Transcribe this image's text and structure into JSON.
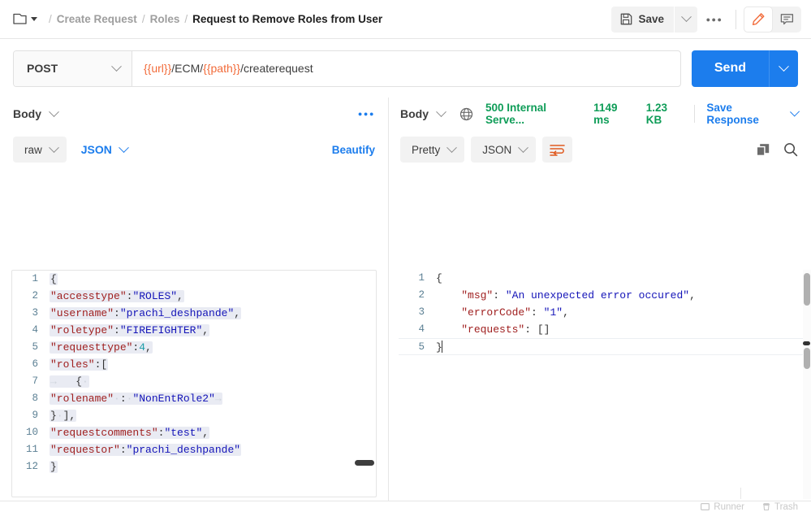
{
  "header": {
    "breadcrumb": {
      "folder_icon": "folder-icon",
      "caret_icon": "caret-down-icon",
      "sep": "/",
      "items": [
        {
          "label": "Create Request",
          "current": false
        },
        {
          "label": "Roles",
          "current": false
        },
        {
          "label": "Request to Remove Roles from User",
          "current": true
        }
      ]
    },
    "save_label": "Save",
    "save_icon": "floppy-disk-icon",
    "save_caret_icon": "chevron-down-icon",
    "more_label": "000",
    "more_icon": "ellipsis-icon",
    "edit_icon": "pencil-icon",
    "comment_icon": "comment-icon"
  },
  "request": {
    "method": "POST",
    "method_caret_icon": "chevron-down-icon",
    "url_parts": [
      {
        "text": "{{url}}",
        "variable": true
      },
      {
        "text": "/ECM/",
        "variable": false
      },
      {
        "text": "{{path}}",
        "variable": true
      },
      {
        "text": "/createrequest",
        "variable": false
      }
    ],
    "url_full": "{{url}}/ECM/{{path}}/createrequest",
    "send_label": "Send",
    "send_caret_icon": "chevron-down-icon"
  },
  "request_body": {
    "section_title": "Body",
    "section_caret_icon": "chevron-down-icon",
    "more_icon": "ellipsis-icon",
    "mode_label": "raw",
    "mode_caret_icon": "chevron-down-icon",
    "lang_label": "JSON",
    "lang_caret_icon": "chevron-down-icon",
    "beautify_label": "Beautify",
    "lines": [
      {
        "no": "1",
        "tokens": [
          {
            "t": "{",
            "c": "p"
          }
        ]
      },
      {
        "no": "2",
        "tokens": [
          {
            "t": "\"accesstype\"",
            "c": "k"
          },
          {
            "t": ":",
            "c": "p"
          },
          {
            "t": "\"ROLES\"",
            "c": "s"
          },
          {
            "t": ",",
            "c": "p"
          }
        ]
      },
      {
        "no": "3",
        "tokens": [
          {
            "t": "\"username\"",
            "c": "k"
          },
          {
            "t": ":",
            "c": "p"
          },
          {
            "t": "\"prachi_deshpande\"",
            "c": "s"
          },
          {
            "t": ",",
            "c": "p"
          }
        ]
      },
      {
        "no": "4",
        "tokens": [
          {
            "t": "\"roletype\"",
            "c": "k"
          },
          {
            "t": ":",
            "c": "p"
          },
          {
            "t": "\"FIREFIGHTER\"",
            "c": "s"
          },
          {
            "t": ",",
            "c": "p"
          }
        ]
      },
      {
        "no": "5",
        "tokens": [
          {
            "t": "\"requesttype\"",
            "c": "k"
          },
          {
            "t": ":",
            "c": "p"
          },
          {
            "t": "4",
            "c": "n"
          },
          {
            "t": ",",
            "c": "p"
          }
        ]
      },
      {
        "no": "6",
        "tokens": [
          {
            "t": "\"roles\"",
            "c": "k"
          },
          {
            "t": ":[",
            "c": "p"
          }
        ]
      },
      {
        "no": "7",
        "tokens": [
          {
            "t": "→",
            "c": "ws"
          },
          {
            "t": "   ",
            "c": "p"
          },
          {
            "t": "{",
            "c": "p"
          },
          {
            "t": "·",
            "c": "ws"
          }
        ]
      },
      {
        "no": "8",
        "tokens": [
          {
            "t": "\"rolename\"",
            "c": "k"
          },
          {
            "t": "·",
            "c": "ws"
          },
          {
            "t": ":",
            "c": "p"
          },
          {
            "t": "·",
            "c": "ws"
          },
          {
            "t": "\"NonEntRole2\"",
            "c": "s"
          },
          {
            "t": "→",
            "c": "ws"
          }
        ]
      },
      {
        "no": "9",
        "tokens": [
          {
            "t": "}",
            "c": "p"
          },
          {
            "t": "·",
            "c": "ws"
          },
          {
            "t": "],",
            "c": "p"
          }
        ]
      },
      {
        "no": "10",
        "tokens": [
          {
            "t": "\"requestcomments\"",
            "c": "k"
          },
          {
            "t": ":",
            "c": "p"
          },
          {
            "t": "\"test\"",
            "c": "s"
          },
          {
            "t": ",",
            "c": "p"
          }
        ]
      },
      {
        "no": "11",
        "tokens": [
          {
            "t": "\"requestor\"",
            "c": "k"
          },
          {
            "t": ":",
            "c": "p"
          },
          {
            "t": "\"prachi_deshpande\"",
            "c": "s"
          }
        ]
      },
      {
        "no": "12",
        "tokens": [
          {
            "t": "}",
            "c": "p"
          }
        ]
      }
    ]
  },
  "response": {
    "section_title": "Body",
    "section_caret_icon": "chevron-down-icon",
    "globe_icon": "globe-icon",
    "status": "500 Internal Serve...",
    "status_color": "#0f9d58",
    "time": "1149 ms",
    "size": "1.23 KB",
    "save_response_label": "Save Response",
    "save_response_caret_icon": "chevron-down-icon",
    "view_label": "Pretty",
    "view_caret_icon": "chevron-down-icon",
    "lang_label": "JSON",
    "lang_caret_icon": "chevron-down-icon",
    "wrap_icon": "word-wrap-icon",
    "copy_icon": "copy-icon",
    "search_icon": "search-icon",
    "lines": [
      {
        "no": "1",
        "tokens": [
          {
            "t": "{",
            "c": "p"
          }
        ]
      },
      {
        "no": "2",
        "tokens": [
          {
            "t": "    ",
            "c": "p"
          },
          {
            "t": "\"msg\"",
            "c": "k"
          },
          {
            "t": ": ",
            "c": "p"
          },
          {
            "t": "\"An unexpected error occured\"",
            "c": "s"
          },
          {
            "t": ",",
            "c": "p"
          }
        ]
      },
      {
        "no": "3",
        "tokens": [
          {
            "t": "    ",
            "c": "p"
          },
          {
            "t": "\"errorCode\"",
            "c": "k"
          },
          {
            "t": ": ",
            "c": "p"
          },
          {
            "t": "\"1\"",
            "c": "s"
          },
          {
            "t": ",",
            "c": "p"
          }
        ]
      },
      {
        "no": "4",
        "tokens": [
          {
            "t": "    ",
            "c": "p"
          },
          {
            "t": "\"requests\"",
            "c": "k"
          },
          {
            "t": ": []",
            "c": "p"
          }
        ]
      },
      {
        "no": "5",
        "tokens": [
          {
            "t": "}",
            "c": "p"
          }
        ]
      }
    ]
  },
  "footer": {
    "runner_label": "Runner",
    "runner_icon": "runner-icon",
    "trash_label": "Trash",
    "trash_icon": "trash-icon"
  },
  "colors": {
    "accent_blue": "#1c7ded",
    "accent_orange": "#f26b3a",
    "status_green": "#0f9d58",
    "key_red": "#a02020",
    "string_blue": "#1414b8",
    "number_teal": "#1a9ca8",
    "line_number": "#5c8094",
    "highlight": "#e9ebf3"
  }
}
